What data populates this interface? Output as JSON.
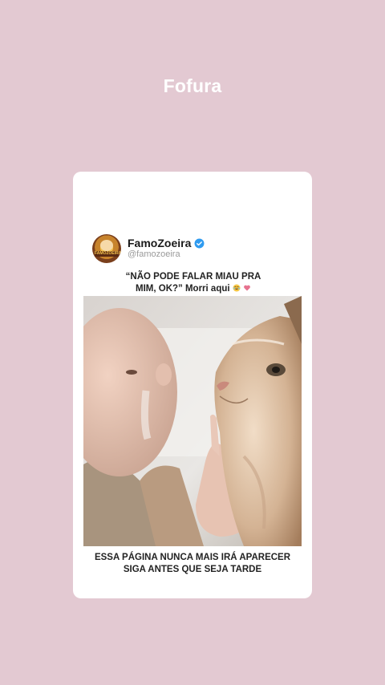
{
  "story": {
    "title": "Fofura"
  },
  "post": {
    "display_name": "FamoZoeira",
    "handle": "@famozoeira",
    "avatar_text": "FAMOZOEIRA",
    "caption_line1": "“NÃO PODE FALAR MIAU PRA",
    "caption_line2": "MIM, OK?” Morri aqui",
    "footer_line1": "ESSA PÁGINA NUNCA MAIS IRÁ APARECER",
    "footer_line2": "SIGA ANTES QUE SEJA TARDE"
  },
  "colors": {
    "background": "#e3c9d2",
    "card": "#ffffff",
    "verified": "#2f9bf0"
  }
}
